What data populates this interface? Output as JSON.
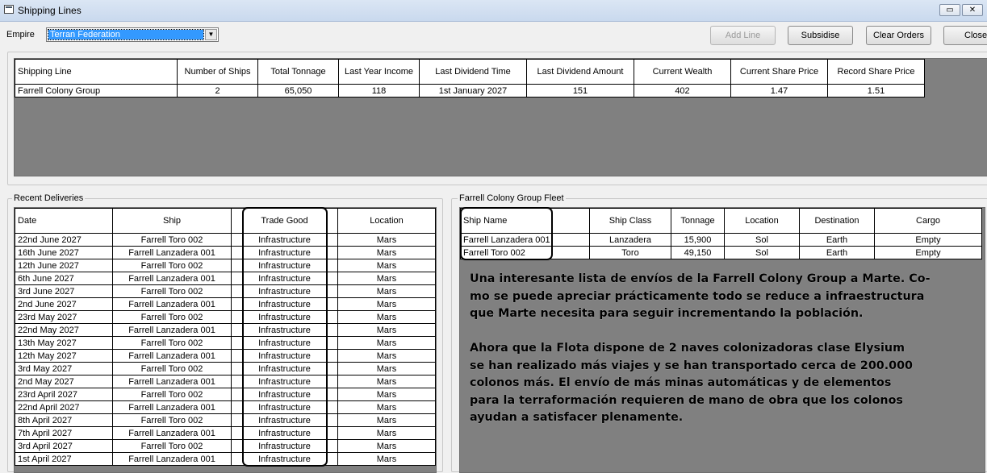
{
  "window": {
    "title": "Shipping Lines"
  },
  "controls": {
    "minimize_glyph": "▭",
    "close_glyph": "✕",
    "empire_label": "Empire",
    "empire_value": "Terran Federation",
    "dropdown_arrow": "▼",
    "add_line_label": "Add Line",
    "subsidise_label": "Subsidise",
    "clear_orders_label": "Clear Orders",
    "close_label": "Close"
  },
  "shipping_lines": {
    "headers": [
      "Shipping Line",
      "Number of Ships",
      "Total Tonnage",
      "Last Year Income",
      "Last Dividend Time",
      "Last Dividend Amount",
      "Current Wealth",
      "Current Share Price",
      "Record Share Price"
    ],
    "rows": [
      [
        "Farrell Colony Group",
        "2",
        "65,050",
        "118",
        "1st January 2027",
        "151",
        "402",
        "1.47",
        "1.51"
      ]
    ]
  },
  "recent_deliveries": {
    "group_label": "Recent Deliveries",
    "headers": [
      "Date",
      "Ship",
      "Trade Good",
      "Location"
    ],
    "rows": [
      [
        "22nd June 2027",
        "Farrell Toro 002",
        "Infrastructure",
        "Mars"
      ],
      [
        "16th June 2027",
        "Farrell Lanzadera 001",
        "Infrastructure",
        "Mars"
      ],
      [
        "12th June 2027",
        "Farrell Toro 002",
        "Infrastructure",
        "Mars"
      ],
      [
        "6th June 2027",
        "Farrell Lanzadera 001",
        "Infrastructure",
        "Mars"
      ],
      [
        "3rd June 2027",
        "Farrell Toro 002",
        "Infrastructure",
        "Mars"
      ],
      [
        "2nd June 2027",
        "Farrell Lanzadera 001",
        "Infrastructure",
        "Mars"
      ],
      [
        "23rd May 2027",
        "Farrell Toro 002",
        "Infrastructure",
        "Mars"
      ],
      [
        "22nd May 2027",
        "Farrell Lanzadera 001",
        "Infrastructure",
        "Mars"
      ],
      [
        "13th May 2027",
        "Farrell Toro 002",
        "Infrastructure",
        "Mars"
      ],
      [
        "12th May 2027",
        "Farrell Lanzadera 001",
        "Infrastructure",
        "Mars"
      ],
      [
        "3rd May 2027",
        "Farrell Toro 002",
        "Infrastructure",
        "Mars"
      ],
      [
        "2nd May 2027",
        "Farrell Lanzadera 001",
        "Infrastructure",
        "Mars"
      ],
      [
        "23rd April 2027",
        "Farrell Toro 002",
        "Infrastructure",
        "Mars"
      ],
      [
        "22nd April 2027",
        "Farrell Lanzadera 001",
        "Infrastructure",
        "Mars"
      ],
      [
        "8th April 2027",
        "Farrell Toro 002",
        "Infrastructure",
        "Mars"
      ],
      [
        "7th April 2027",
        "Farrell Lanzadera 001",
        "Infrastructure",
        "Mars"
      ],
      [
        "3rd April 2027",
        "Farrell Toro 002",
        "Infrastructure",
        "Mars"
      ],
      [
        "1st April 2027",
        "Farrell Lanzadera 001",
        "Infrastructure",
        "Mars"
      ]
    ]
  },
  "fleet": {
    "group_label": "Farrell Colony Group Fleet",
    "headers": [
      "Ship Name",
      "Ship Class",
      "Tonnage",
      "Location",
      "Destination",
      "Cargo"
    ],
    "rows": [
      [
        "Farrell Lanzadera 001",
        "Lanzadera",
        "15,900",
        "Sol",
        "Earth",
        "Empty"
      ],
      [
        "Farrell Toro 002",
        "Toro",
        "49,150",
        "Sol",
        "Earth",
        "Empty"
      ]
    ]
  },
  "annotation": {
    "paragraph1": [
      "Una interesante lista de envíos de la Farrell Colony Group a Marte. Co-",
      "mo se puede apreciar prácticamente todo se reduce a infraestructura",
      "que Marte necesita para seguir incrementando la población."
    ],
    "paragraph2": [
      "Ahora que la Flota dispone de 2 naves colonizadoras clase Elysium",
      "se han realizado más viajes y se han transportado cerca de 200.000",
      "colonos más. El envío de más minas automáticas y de elementos",
      "para la terraformación requieren de mano de obra que los colonos",
      "ayudan a satisfacer plenamente."
    ]
  }
}
